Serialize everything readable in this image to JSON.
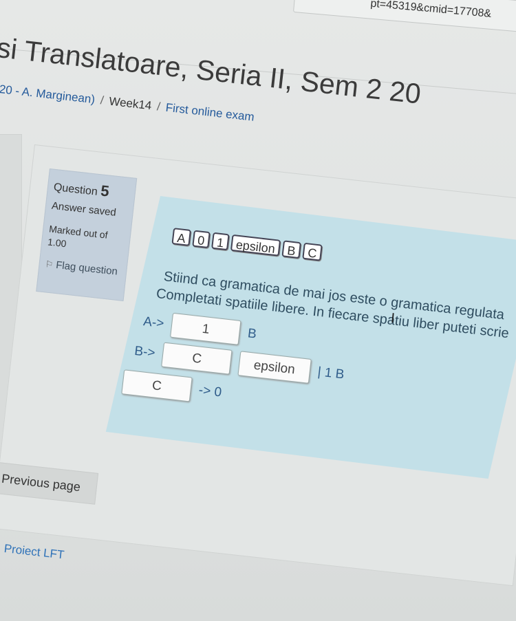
{
  "browser": {
    "url_fragment": "pt=45319&cmid=17708&"
  },
  "header": {
    "title": "si Translatoare, Seria II, Sem 2 20",
    "breadcrumb": [
      "20 - A. Marginean)",
      "Week14",
      "First online exam"
    ]
  },
  "question_info": {
    "label": "Question",
    "number": "5",
    "status": "Answer saved",
    "marked_label": "Marked out of",
    "marked_value": "1.00",
    "flag_label": "Flag question",
    "flag_icon": "flag-icon"
  },
  "question": {
    "tokens": [
      "A",
      "0",
      "1",
      "epsilon",
      "B",
      "C"
    ],
    "text_line1": "Stiind ca gramatica de mai jos este o gramatica regulata",
    "text_line2": "Completati spatiile libere. In fiecare spatiu liber puteti scrie",
    "rule_a": {
      "lhs": "A->",
      "drop1": "1",
      "suffix": "B"
    },
    "rule_b": {
      "lhs": "B->",
      "drop1": "C",
      "drop2": "epsilon",
      "suffix": "| 1 B"
    },
    "rule_c": {
      "drop1": "C",
      "suffix": "-> 0"
    }
  },
  "nav": {
    "previous_page": "Previous page"
  },
  "footer": {
    "link": "Proiect LFT"
  }
}
